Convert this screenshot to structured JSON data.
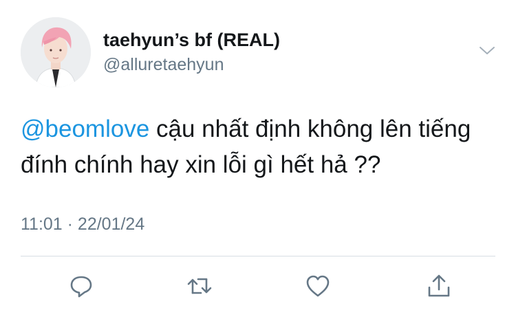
{
  "tweet": {
    "author": {
      "display_name": "taehyun’s bf (REAL)",
      "handle": "@alluretaehyun",
      "avatar_icon": "profile-photo"
    },
    "text": {
      "mention": "@beomlove",
      "body": " cậu nhất định không lên tiếng đính chính hay xin lỗi gì hết hả ??"
    },
    "timestamp": "11:01 · 22/01/24"
  },
  "actions": {
    "reply_icon": "reply-icon",
    "retweet_icon": "retweet-icon",
    "like_icon": "heart-icon",
    "share_icon": "share-icon"
  },
  "colors": {
    "mention": "#1b95e0",
    "secondary_text": "#657786",
    "icon": "#657786",
    "primary_text": "#14171a",
    "divider": "#d7dde3"
  }
}
